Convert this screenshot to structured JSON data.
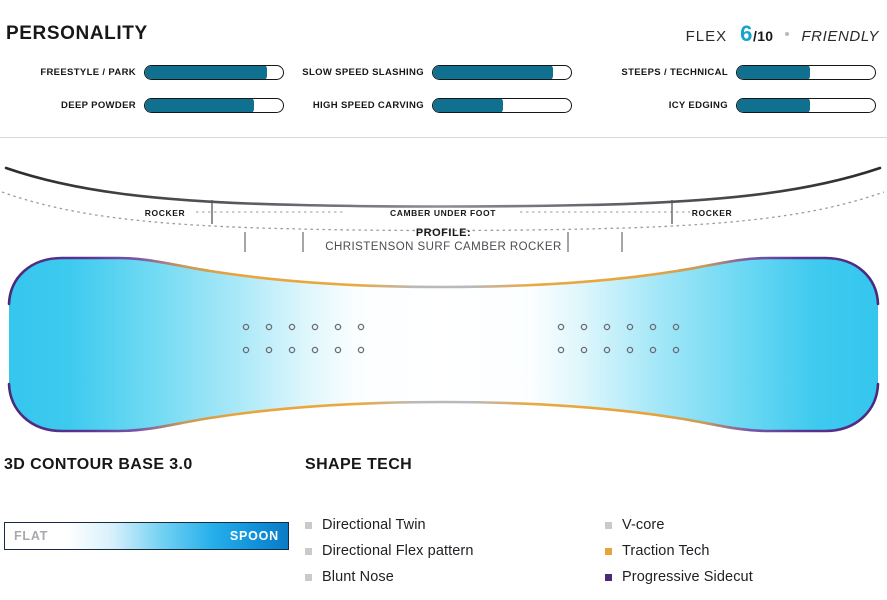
{
  "header": {
    "title": "PERSONALITY",
    "flex_label": "FLEX",
    "flex_score": "6",
    "flex_out_of": "/10",
    "flex_word": "FRIENDLY",
    "accent_color": "#17a3cc"
  },
  "personality": {
    "columns": [
      {
        "rows": [
          {
            "label": "FREESTYLE / PARK",
            "value": 88
          },
          {
            "label": "DEEP POWDER",
            "value": 78
          }
        ]
      },
      {
        "rows": [
          {
            "label": "SLOW SPEED SLASHING",
            "value": 86
          },
          {
            "label": "HIGH SPEED CARVING",
            "value": 50
          }
        ]
      },
      {
        "rows": [
          {
            "label": "STEEPS / TECHNICAL",
            "value": 52
          },
          {
            "label": "ICY EDGING",
            "value": 52
          }
        ]
      }
    ],
    "fill_color": "#10708f",
    "track_border_color": "#17171a"
  },
  "profile": {
    "zone_left_label": "ROCKER",
    "zone_center_label": "CAMBER UNDER FOOT",
    "zone_right_label": "ROCKER",
    "caption_title": "PROFILE:",
    "caption_subtitle": "CHRISTENSON SURF CAMBER ROCKER"
  },
  "board": {
    "tip_color": "#3fc8ef",
    "edge_orange": "#e8a33c",
    "edge_purple": "#4b2a7a",
    "insert_rows": 2,
    "inserts_per_row": 6
  },
  "contour": {
    "title": "3D CONTOUR BASE 3.0",
    "scale_left": "FLAT",
    "scale_right": "SPOON"
  },
  "shape_tech": {
    "title": "SHAPE TECH",
    "left_items": [
      {
        "label": "Directional Twin",
        "color": "#c9c9ce"
      },
      {
        "label": "Directional Flex pattern",
        "color": "#c9c9ce"
      },
      {
        "label": "Blunt Nose",
        "color": "#c9c9ce"
      }
    ],
    "right_items": [
      {
        "label": "V-core",
        "color": "#c9c9ce"
      },
      {
        "label": "Traction Tech",
        "color": "#e8a33c"
      },
      {
        "label": "Progressive Sidecut",
        "color": "#4b2a7a"
      }
    ]
  }
}
